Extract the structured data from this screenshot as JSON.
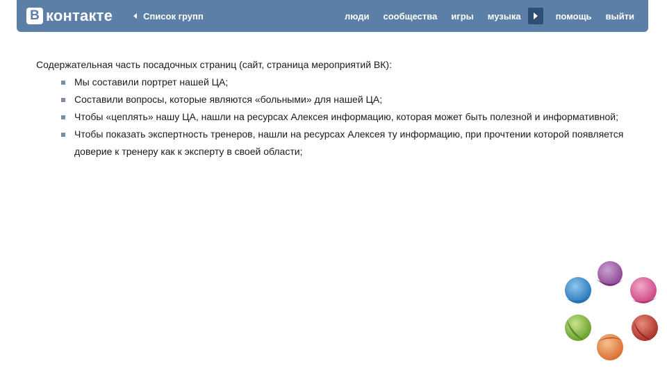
{
  "header": {
    "logo_letter": "B",
    "logo_text": "контакте",
    "back_label": "Список групп",
    "nav": [
      "люди",
      "сообщества",
      "игры",
      "музыка"
    ],
    "nav_after": [
      "помощь",
      "выйти"
    ],
    "colors": {
      "bar": "#5b7fa6",
      "arrow_bg": "#2f4f72"
    }
  },
  "content": {
    "intro": "Содержательная часть посадочных страниц (сайт, страница мероприятий ВК):",
    "bullets": [
      "Мы составили портрет нашей ЦА;",
      "Составили вопросы, которые являются «больными» для нашей ЦА;",
      "Чтобы «цеплять» нашу ЦА, нашли на ресурсах Алексея информацию, которая может быть полезной и информативной;",
      "Чтобы показать экспертность тренеров, нашли на ресурсах Алексея ту информацию, при прочтении которой появляется доверие к тренеру как к эксперту в своей области;"
    ]
  },
  "decoration": {
    "icon": "colored-circles-logo-icon",
    "colors": [
      "#9b4e9e",
      "#d2528f",
      "#c0392b",
      "#e07b3a",
      "#7fb03a",
      "#2e86c9"
    ]
  }
}
